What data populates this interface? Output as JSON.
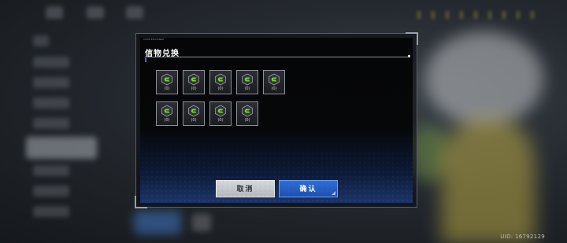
{
  "background": {
    "uid_text": "UID: 16792129"
  },
  "modal": {
    "header_tag": "CODE EXCHANGE",
    "title": "信物兑换",
    "items": [
      {
        "count": "(0)",
        "icon": "green-token-icon"
      },
      {
        "count": "(0)",
        "icon": "green-token-icon"
      },
      {
        "count": "(0)",
        "icon": "green-token-icon"
      },
      {
        "count": "(0)",
        "icon": "green-token-icon"
      },
      {
        "count": "(0)",
        "icon": "green-token-icon"
      },
      {
        "count": "(0)",
        "icon": "green-token-icon"
      },
      {
        "count": "(0)",
        "icon": "green-token-icon"
      },
      {
        "count": "(0)",
        "icon": "green-token-icon"
      },
      {
        "count": "(0)",
        "icon": "green-token-icon"
      }
    ],
    "cancel_label": "取消",
    "confirm_label": "确认"
  },
  "colors": {
    "accent_blue": "#2e6ed8",
    "token_green": "#7ed321"
  }
}
